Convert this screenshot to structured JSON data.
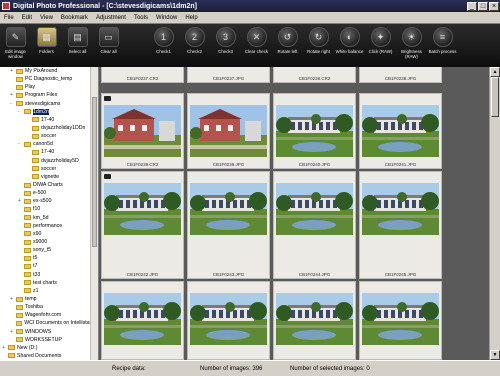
{
  "window": {
    "title": "Digital Photo Professional - [C:\\stevesdigicams\\1dm2n]"
  },
  "menu": [
    "File",
    "Edit",
    "View",
    "Bookmark",
    "Adjustment",
    "Tools",
    "Window",
    "Help"
  ],
  "toolbar": {
    "left": [
      {
        "label": "Edit image window",
        "icon": "edit-image-icon"
      },
      {
        "label": "Folders",
        "icon": "folders-icon"
      },
      {
        "label": "Select all",
        "icon": "select-all-icon"
      },
      {
        "label": "Clear all",
        "icon": "clear-all-icon"
      }
    ],
    "right": [
      {
        "label": "Check1",
        "icon": "check1-icon"
      },
      {
        "label": "Check2",
        "icon": "check2-icon"
      },
      {
        "label": "Check3",
        "icon": "check3-icon"
      },
      {
        "label": "Clear check",
        "icon": "clear-check-icon"
      },
      {
        "label": "Rotate left",
        "icon": "rotate-left-icon"
      },
      {
        "label": "Rotate right",
        "icon": "rotate-right-icon"
      },
      {
        "label": "White balance",
        "icon": "white-balance-icon"
      },
      {
        "label": "Click (RAW)",
        "icon": "click-raw-icon"
      },
      {
        "label": "Brightness (RAW)",
        "icon": "brightness-raw-icon"
      },
      {
        "label": "Batch process",
        "icon": "batch-process-icon"
      }
    ]
  },
  "tree": [
    {
      "label": "My PixAround",
      "indent": 0,
      "expander": "+",
      "selected": false
    },
    {
      "label": "PC Diagnostic_temp",
      "indent": 0,
      "expander": "",
      "selected": false
    },
    {
      "label": "Play",
      "indent": 0,
      "expander": "",
      "selected": false
    },
    {
      "label": "Program Files",
      "indent": 0,
      "expander": "+",
      "selected": false
    },
    {
      "label": "stevesdigicams",
      "indent": 0,
      "expander": "-",
      "selected": false
    },
    {
      "label": "1dm2n",
      "indent": 1,
      "expander": "-",
      "selected": true
    },
    {
      "label": "17-40",
      "indent": 2,
      "expander": "",
      "selected": false
    },
    {
      "label": "dvjazzholiday1DDn",
      "indent": 2,
      "expander": "",
      "selected": false
    },
    {
      "label": "soccer",
      "indent": 2,
      "expander": "",
      "selected": false
    },
    {
      "label": "canon5d",
      "indent": 1,
      "expander": "-",
      "selected": false
    },
    {
      "label": "17-40",
      "indent": 2,
      "expander": "",
      "selected": false
    },
    {
      "label": "dvjazzholiday5D",
      "indent": 2,
      "expander": "",
      "selected": false
    },
    {
      "label": "soccer",
      "indent": 2,
      "expander": "",
      "selected": false
    },
    {
      "label": "vignette",
      "indent": 2,
      "expander": "",
      "selected": false
    },
    {
      "label": "DIWA Charts",
      "indent": 1,
      "expander": "",
      "selected": false
    },
    {
      "label": "e-500",
      "indent": 1,
      "expander": "",
      "selected": false
    },
    {
      "label": "ex-s500",
      "indent": 1,
      "expander": "+",
      "selected": false
    },
    {
      "label": "f10",
      "indent": 1,
      "expander": "",
      "selected": false
    },
    {
      "label": "km_5d",
      "indent": 1,
      "expander": "",
      "selected": false
    },
    {
      "label": "performance",
      "indent": 1,
      "expander": "",
      "selected": false
    },
    {
      "label": "s90",
      "indent": 1,
      "expander": "",
      "selected": false
    },
    {
      "label": "s9000",
      "indent": 1,
      "expander": "",
      "selected": false
    },
    {
      "label": "sony_t5",
      "indent": 1,
      "expander": "",
      "selected": false
    },
    {
      "label": "t5",
      "indent": 1,
      "expander": "",
      "selected": false
    },
    {
      "label": "t7",
      "indent": 1,
      "expander": "",
      "selected": false
    },
    {
      "label": "t33",
      "indent": 1,
      "expander": "",
      "selected": false
    },
    {
      "label": "test charts",
      "indent": 1,
      "expander": "",
      "selected": false
    },
    {
      "label": "z1",
      "indent": 1,
      "expander": "",
      "selected": false
    },
    {
      "label": "temp",
      "indent": 0,
      "expander": "+",
      "selected": false
    },
    {
      "label": "Toshiba",
      "indent": 0,
      "expander": "",
      "selected": false
    },
    {
      "label": "Wagenfohr.com",
      "indent": 0,
      "expander": "",
      "selected": false
    },
    {
      "label": "WCI Documents on Intellistation",
      "indent": 0,
      "expander": "",
      "selected": false
    },
    {
      "label": "WINDOWS",
      "indent": 0,
      "expander": "+",
      "selected": false
    },
    {
      "label": "WORKSSETUP",
      "indent": 0,
      "expander": "",
      "selected": false
    },
    {
      "label": "New (D:)",
      "indent": -1,
      "expander": "+",
      "selected": false
    },
    {
      "label": "Shared Documents",
      "indent": -1,
      "expander": "",
      "selected": false
    }
  ],
  "grid": {
    "rows": [
      {
        "photos": [
          {
            "filename": "CB1F0237.CR2",
            "scene": "cut"
          },
          {
            "filename": "CB1F0237.JPG",
            "scene": "cut"
          },
          {
            "filename": "CB1F0238.CR2",
            "scene": "cut"
          },
          {
            "filename": "CB1F0238.JPG",
            "scene": "cut"
          }
        ]
      },
      {
        "photos": [
          {
            "filename": "CB1F0239.CR2",
            "scene": "house"
          },
          {
            "filename": "CB1F0239.JPG",
            "scene": "house"
          },
          {
            "filename": "CB1F0240.JPG",
            "scene": "building"
          },
          {
            "filename": "CB1F0241.JPG",
            "scene": "building"
          }
        ]
      },
      {
        "photos": [
          {
            "filename": "CB1F0242.JPG",
            "scene": "building"
          },
          {
            "filename": "CB1F0243.JPG",
            "scene": "building"
          },
          {
            "filename": "CB1F0244.JPG",
            "scene": "building"
          },
          {
            "filename": "CB1F0245.JPG",
            "scene": "building"
          }
        ]
      },
      {
        "photos": [
          {
            "filename": "",
            "scene": "building"
          },
          {
            "filename": "",
            "scene": "building"
          },
          {
            "filename": "",
            "scene": "building"
          },
          {
            "filename": "",
            "scene": "building"
          }
        ]
      }
    ]
  },
  "status": {
    "recipe_label": "Recipe data:",
    "images": "Number of images: 396",
    "selected": "Number of selected images: 0"
  },
  "colors": {
    "toolbar_bg": "#1a1a1a",
    "content_bg": "#5a5a5a",
    "selection": "#0a246a",
    "titlebar": "#1b1f3a"
  }
}
